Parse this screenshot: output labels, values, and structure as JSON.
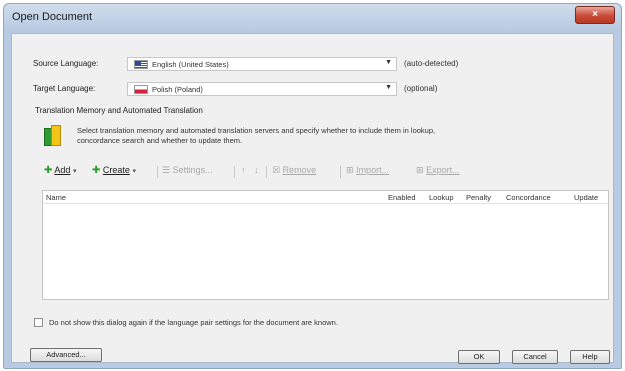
{
  "window": {
    "title": "Open Document",
    "close_glyph": "×"
  },
  "source_language": {
    "label": "Source Language:",
    "value": "English (United States)",
    "flag": "us-flag-icon",
    "note": "(auto-detected)"
  },
  "target_language": {
    "label": "Target Language:",
    "value": "Polish (Poland)",
    "flag": "pl-flag-icon",
    "note": "(optional)"
  },
  "tm_section": {
    "title": "Translation Memory and Automated Translation",
    "description_line1": "Select translation memory and automated translation servers and specify whether to include them in lookup,",
    "description_line2": "concordance search and whether to update them."
  },
  "toolbar": {
    "add": "Add",
    "create": "Create",
    "settings": "Settings...",
    "move_up": "↑",
    "move_down": "↓",
    "remove": "Remove",
    "import": "Import...",
    "export": "Export..."
  },
  "list": {
    "columns": [
      "Name",
      "Enabled",
      "Lookup",
      "Penalty",
      "Concordance",
      "Update"
    ],
    "rows": []
  },
  "checkbox": {
    "label": "Do not show this dialog again if the language pair settings for the document are known.",
    "checked": false
  },
  "buttons": {
    "advanced": "Advanced...",
    "ok": "OK",
    "cancel": "Cancel",
    "help": "Help"
  }
}
